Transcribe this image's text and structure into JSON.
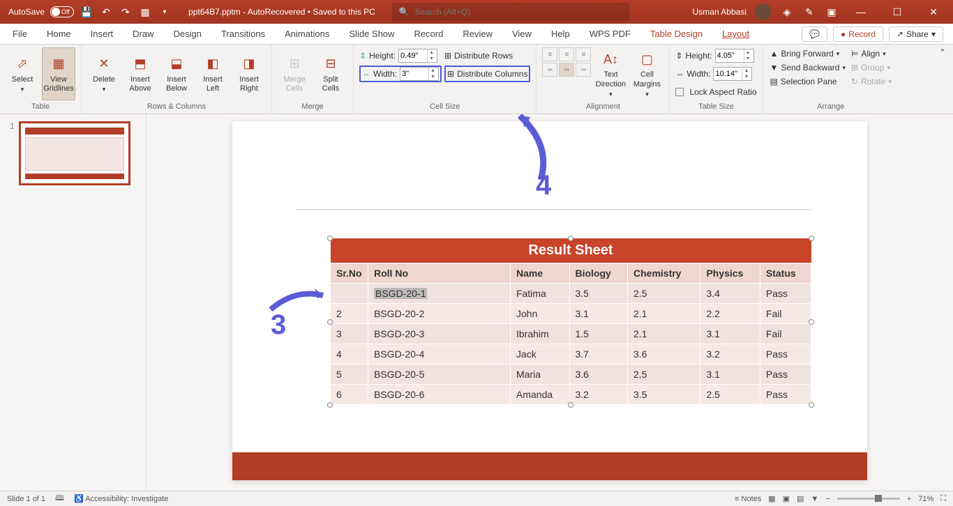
{
  "titlebar": {
    "autosave_label": "AutoSave",
    "autosave_state": "Off",
    "doc_title": "ppt64B7.pptm  -  AutoRecovered • Saved to this PC",
    "search_placeholder": "Search (Alt+Q)",
    "user_name": "Usman Abbasi"
  },
  "menu": {
    "tabs": [
      "File",
      "Home",
      "Insert",
      "Draw",
      "Design",
      "Transitions",
      "Animations",
      "Slide Show",
      "Record",
      "Review",
      "View",
      "Help",
      "WPS PDF",
      "Table Design",
      "Layout"
    ],
    "comments_icon": "💬",
    "record_label": "Record",
    "share_label": "Share"
  },
  "ribbon": {
    "table": {
      "select": "Select",
      "gridlines": "View Gridlines",
      "group": "Table"
    },
    "rows_cols": {
      "delete": "Delete",
      "above": "Insert Above",
      "below": "Insert Below",
      "left": "Insert Left",
      "right": "Insert Right",
      "group": "Rows & Columns"
    },
    "merge": {
      "merge": "Merge Cells",
      "split": "Split Cells",
      "group": "Merge"
    },
    "cell_size": {
      "height_label": "Height:",
      "height_value": "0.49\"",
      "width_label": "Width:",
      "width_value": "3\"",
      "dist_rows": "Distribute Rows",
      "dist_cols": "Distribute Columns",
      "group": "Cell Size"
    },
    "alignment": {
      "text_dir": "Text Direction",
      "cell_margins": "Cell Margins",
      "group": "Alignment"
    },
    "table_size": {
      "height_label": "Height:",
      "height_value": "4.05\"",
      "width_label": "Width:",
      "width_value": "10.14\"",
      "lock": "Lock Aspect Ratio",
      "group": "Table Size"
    },
    "arrange": {
      "forward": "Bring Forward",
      "backward": "Send Backward",
      "sel_pane": "Selection Pane",
      "align": "Align",
      "group_btn": "Group",
      "rotate": "Rotate",
      "group": "Arrange"
    }
  },
  "thumbs": {
    "slide_number": "1"
  },
  "slide": {
    "table_title": "Result  Sheet",
    "headers": [
      "Sr.No",
      "Roll No",
      "Name",
      "Biology",
      "Chemistry",
      "Physics",
      "Status"
    ],
    "rows": [
      [
        "",
        "BSGD-20-1",
        "Fatima",
        "3.5",
        "2.5",
        "3.4",
        "Pass"
      ],
      [
        "2",
        "BSGD-20-2",
        "John",
        "3.1",
        "2.1",
        "2.2",
        "Fail"
      ],
      [
        "3",
        "BSGD-20-3",
        "Ibrahim",
        "1.5",
        "2.1",
        "3.1",
        "Fail"
      ],
      [
        "4",
        "BSGD-20-4",
        "Jack",
        "3.7",
        "3.6",
        "3.2",
        "Pass"
      ],
      [
        "5",
        "BSGD-20-5",
        "Maria",
        "3.6",
        "2.5",
        "3.1",
        "Pass"
      ],
      [
        "6",
        "BSGD-20-6",
        "Amanda",
        "3.2",
        "3.5",
        "2.5",
        "Pass"
      ]
    ]
  },
  "annotations": {
    "three": "3",
    "four": "4"
  },
  "status": {
    "slide_info": "Slide 1 of 1",
    "accessibility": "Accessibility: Investigate",
    "notes": "Notes",
    "zoom": "71%"
  }
}
